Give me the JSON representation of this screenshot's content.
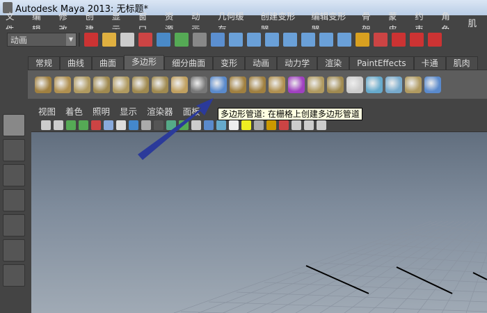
{
  "title": "Autodesk Maya 2013: 无标题*",
  "menu": [
    "文件",
    "编辑",
    "修改",
    "创建",
    "显示",
    "窗口",
    "资源",
    "动画",
    "几何缓存",
    "创建变形器",
    "编辑变形器",
    "骨架",
    "蒙皮",
    "约束",
    "角色",
    "肌"
  ],
  "toolbar": {
    "mode": "动画",
    "icon_colors": [
      "#c33",
      "#e0b040",
      "#ccc",
      "#c44",
      "#4a8ac8",
      "#5a5",
      "#888",
      "#5b8fd0",
      "#6aa0d8",
      "#6aa0d8",
      "#6aa0d8",
      "#6aa0d8",
      "#6aa0d8",
      "#6aa0d8",
      "#6aa0d8",
      "#d8a020",
      "#c44",
      "#c33",
      "#c33",
      "#c33"
    ]
  },
  "shelf": {
    "tabs": [
      "常规",
      "曲线",
      "曲面",
      "多边形",
      "细分曲面",
      "变形",
      "动画",
      "动力学",
      "渲染",
      "PaintEffects",
      "卡通",
      "肌肉"
    ],
    "active_tab": "多边形"
  },
  "viewport": {
    "menu": [
      "视图",
      "着色",
      "照明",
      "显示",
      "渲染器",
      "面板"
    ]
  },
  "tooltip": "多边形管道: 在栅格上创建多边形管道",
  "annotation_color": "#2b3a9a"
}
